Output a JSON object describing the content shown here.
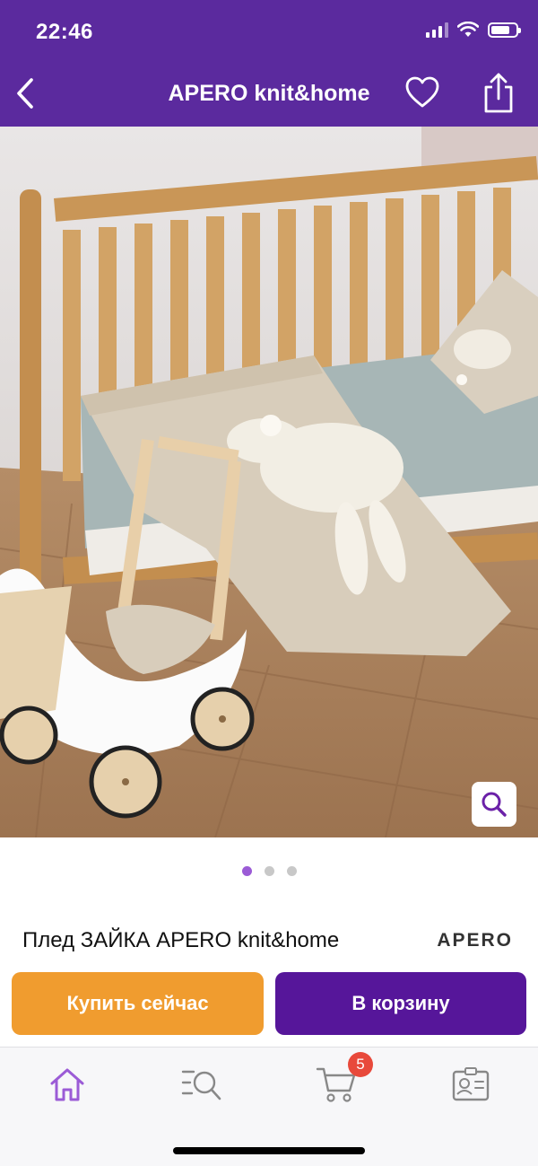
{
  "status_bar": {
    "time": "22:46"
  },
  "nav": {
    "title": "APERO knit&home"
  },
  "icons": {
    "back": "chevron-left-icon",
    "favorite": "heart-icon",
    "share": "share-icon",
    "zoom": "magnifier-icon",
    "home": "home-icon",
    "catalog_search": "search-list-icon",
    "cart": "cart-icon",
    "profile": "profile-card-icon"
  },
  "gallery": {
    "page_count": 3,
    "active_index": 0
  },
  "product": {
    "title": "Плед ЗАЙКА APERO knit&home",
    "brand_logo": "APERO"
  },
  "actions": {
    "buy_now": "Купить сейчас",
    "add_to_cart": "В корзину"
  },
  "tab_bar": {
    "cart_badge": "5"
  },
  "colors": {
    "header": "#5b2a9e",
    "buy_now": "#f09c2f",
    "add_to_cart": "#56169a",
    "active_tab": "#9b5bd6",
    "badge": "#e8493b"
  }
}
